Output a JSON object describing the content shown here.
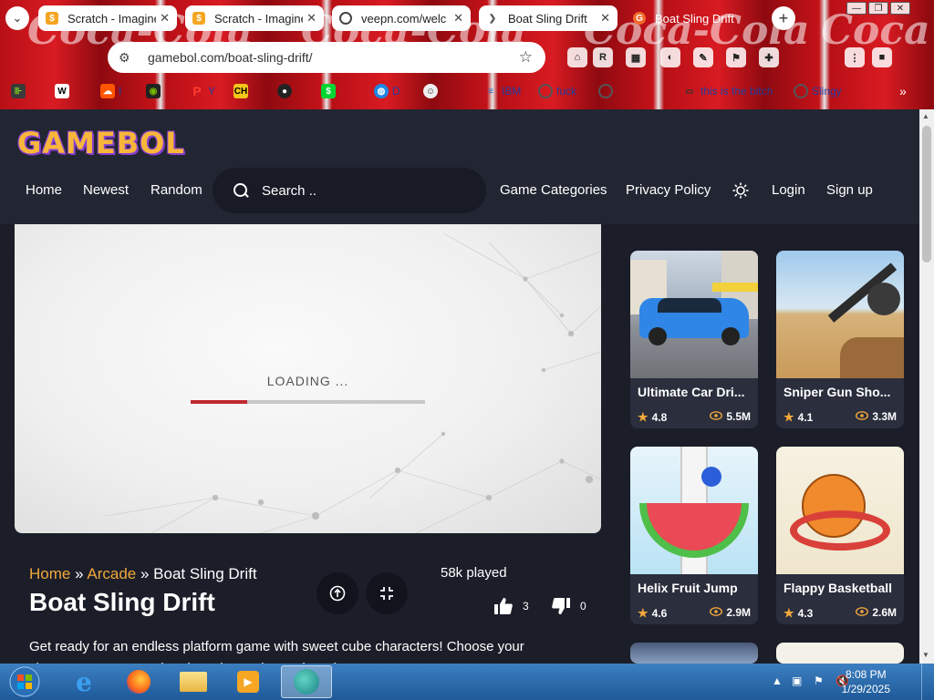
{
  "browser": {
    "tabs": [
      {
        "title": "Scratch - Imagine"
      },
      {
        "title": "Scratch - Imagine"
      },
      {
        "title": "veepn.com/welc"
      },
      {
        "title": "Boat Sling Drift"
      },
      {
        "title": "Boat Sling Drift"
      }
    ],
    "url": "gamebol.com/boat-sling-drift/",
    "bookmarks": [
      {
        "label": "",
        "icon": "bookmark-icon"
      },
      {
        "label": "",
        "icon": "w-icon"
      },
      {
        "label": "I",
        "icon": "soundcloud-icon"
      },
      {
        "label": "",
        "icon": "nvidia-icon"
      },
      {
        "label": "Y",
        "icon": "paypal-icon"
      },
      {
        "label": "",
        "icon": "ch-icon"
      },
      {
        "label": "",
        "icon": "github-icon"
      },
      {
        "label": "",
        "icon": "cash-icon"
      },
      {
        "label": "D",
        "icon": "globe-icon"
      },
      {
        "label": "",
        "icon": "cartoon-icon"
      },
      {
        "label": "IBM",
        "icon": "ibm-icon"
      },
      {
        "label": "fuck",
        "icon": "globe-icon"
      },
      {
        "label": "",
        "icon": "globe-icon"
      },
      {
        "label": "this is the bitch",
        "icon": "folder-icon"
      },
      {
        "label": "Slingy",
        "icon": "globe-icon"
      }
    ]
  },
  "site": {
    "logo": "GAMEBOL",
    "nav": {
      "home": "Home",
      "newest": "Newest",
      "random": "Random",
      "categories": "Game Categories",
      "privacy": "Privacy Policy",
      "login": "Login",
      "signup": "Sign up"
    },
    "search_placeholder": "Search .."
  },
  "player": {
    "loading_text": "LOADING ...",
    "progress": 0.24
  },
  "game": {
    "breadcrumb": {
      "home": "Home",
      "sep1": "»",
      "category": "Arcade",
      "sep2": "»",
      "current": "Boat Sling Drift"
    },
    "title": "Boat Sling Drift",
    "played": "58k played",
    "likes": "3",
    "dislikes": "0",
    "description": "Get ready for an endless platform game with sweet cube characters! Choose your character, overcome the obstacles and start the adventure."
  },
  "sidebar_games": [
    {
      "name": "Ultimate Car Dri...",
      "rating": "4.8",
      "views": "5.5M"
    },
    {
      "name": "Sniper Gun Sho...",
      "rating": "4.1",
      "views": "3.3M"
    },
    {
      "name": "Helix Fruit Jump",
      "rating": "4.6",
      "views": "2.9M"
    },
    {
      "name": "Flappy Basketball",
      "rating": "4.3",
      "views": "2.6M"
    }
  ],
  "taskbar": {
    "time": "8:08 PM",
    "date": "1/29/2025"
  },
  "colors": {
    "accent": "#f2a83b",
    "background": "#1b1e29",
    "header": "#222633",
    "progress": "#c0282f"
  }
}
